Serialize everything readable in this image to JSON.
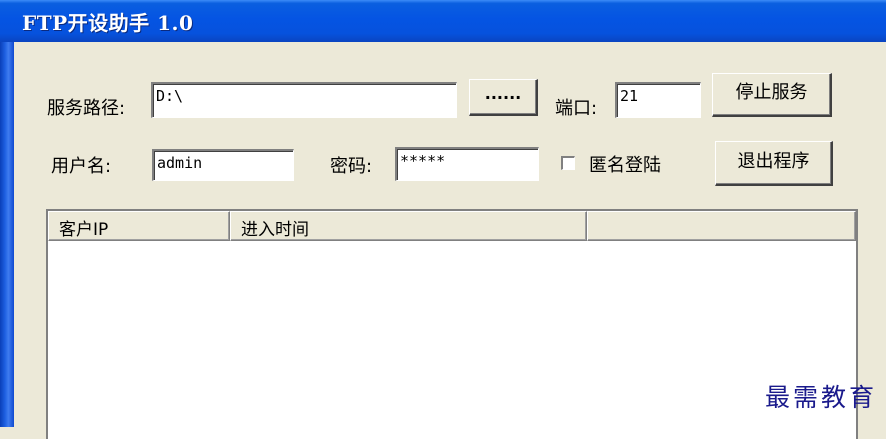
{
  "window": {
    "title": "FTP开设助手  1.0"
  },
  "form": {
    "path_label": "服务路径:",
    "path_value": "D:\\",
    "browse_label": "......",
    "port_label": "端口:",
    "port_value": "21",
    "stop_label": "停止服务",
    "user_label": "用户名:",
    "user_value": "admin",
    "password_label": "密码:",
    "password_value": "*****",
    "anonymous_label": "匿名登陆",
    "anonymous_checked": false,
    "exit_label": "退出程序"
  },
  "table": {
    "columns": [
      "客户IP",
      "进入时间",
      ""
    ],
    "rows": []
  },
  "watermark": "最需教育"
}
